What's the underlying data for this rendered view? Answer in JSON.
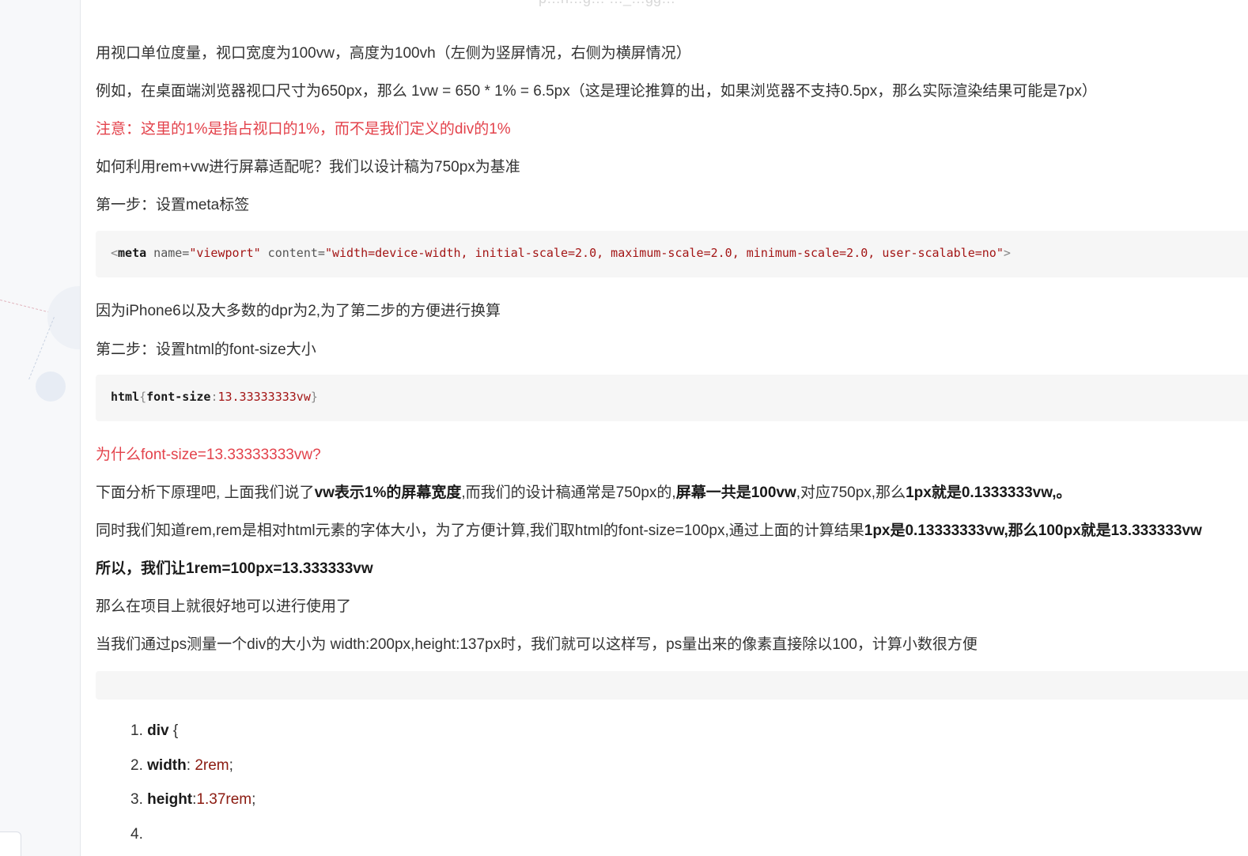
{
  "article": {
    "top_fragment": "p…h…g…   …_…gg…",
    "p1": "用视口单位度量，视口宽度为100vw，高度为100vh（左侧为竖屏情况，右侧为横屏情况）",
    "p2": "例如，在桌面端浏览器视口尺寸为650px，那么 1vw = 650 * 1% = 6.5px（这是理论推算的出，如果浏览器不支持0.5px，那么实际渲染结果可能是7px）",
    "note": "注意：这里的1%是指占视口的1%，而不是我们定义的div的1%",
    "p3": "如何利用rem+vw进行屏幕适配呢？我们以设计稿为750px为基准",
    "step1": "第一步：设置meta标签",
    "code1": {
      "open": "<",
      "tag": "meta",
      "attr1": " name=",
      "val1": "\"viewport\"",
      "attr2": " content=",
      "val2": "\"width=device-width, initial-scale=2.0, maximum-scale=2.0, minimum-scale=2.0, user-scalable=no\"",
      "close": ">"
    },
    "p4": "因为iPhone6以及大多数的dpr为2,为了第二步的方便进行换算",
    "step2": "第二步：设置html的font-size大小",
    "code2": {
      "selector": "html",
      "brace_open": "{",
      "prop": "font-size",
      "colon": ":",
      "value": "13.33333333vw",
      "brace_close": "}"
    },
    "why": "为什么font-size=13.33333333vw?",
    "p5": {
      "t1": "下面分析下原理吧, 上面我们说了",
      "b1": "vw表示1%的屏幕宽度",
      "t2": ",而我们的设计稿通常是750px的,",
      "b2": "屏幕一共是100vw",
      "t3": ",对应750px,那么",
      "b3": "1px就是0.1333333vw,。"
    },
    "p6": {
      "t1": "同时我们知道rem,rem是相对html元素的字体大小，为了方便计算,我们取html的font-size=100px,通过上面的计算结果",
      "b1": "1px是0.13333333vw,那么100px就是13.333333vw"
    },
    "p7": "所以，我们让1rem=100px=13.333333vw",
    "p8": "那么在项目上就很好地可以进行使用了",
    "p9": "当我们通过ps测量一个div的大小为 width:200px,height:137px时，我们就可以这样写，ps量出来的像素直接除以100，计算小数很方便",
    "list": [
      {
        "num": "1.",
        "key": "div",
        "rest": " {",
        "val": ""
      },
      {
        "num": "2.",
        "key": "width",
        "rest": ": ",
        "val": "2rem",
        "end": ";"
      },
      {
        "num": "3.",
        "key": "height",
        "rest": ":",
        "val": "1.37rem",
        "end": ";"
      },
      {
        "num": "4.",
        "key": "",
        "rest": "",
        "val": ""
      }
    ]
  }
}
